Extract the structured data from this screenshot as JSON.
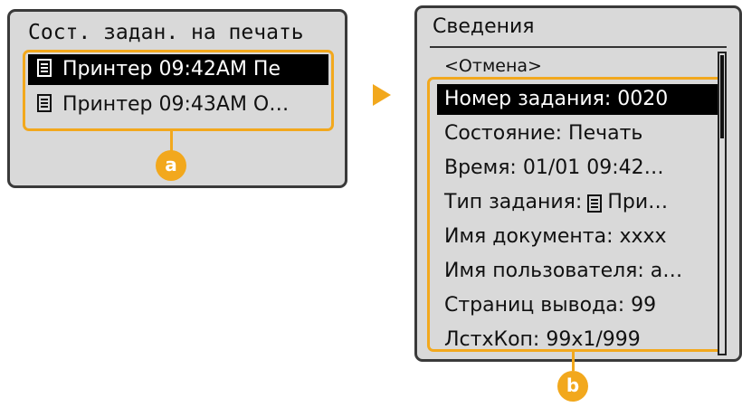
{
  "left_panel": {
    "title": "Сост. задан. на печать",
    "rows": [
      {
        "text": "Принтер 09:42AM Пе",
        "icon": "document-icon",
        "selected": true
      },
      {
        "text": "Принтер 09:43AM О…",
        "icon": "document-icon",
        "selected": false
      }
    ]
  },
  "right_panel": {
    "title": "Сведения",
    "cancel": "<Отмена>",
    "rows": [
      {
        "text": "Номер задания: 0020",
        "selected": true
      },
      {
        "text": "Состояние: Печать"
      },
      {
        "text": "Время: 01/01 09:42…"
      },
      {
        "prefix": "Тип задания:",
        "icon": "document-icon",
        "suffix": "При…"
      },
      {
        "text": "Имя документа: xxxx"
      },
      {
        "text": "Имя пользователя: a…"
      },
      {
        "text": "Страниц вывода: 99"
      },
      {
        "text": "ЛстхКоп: 99x1/999"
      }
    ]
  },
  "callouts": {
    "a": "a",
    "b": "b"
  },
  "colors": {
    "accent": "#f2a81d",
    "panel_bg": "#d9d9d9",
    "selected_bg": "#000000"
  }
}
